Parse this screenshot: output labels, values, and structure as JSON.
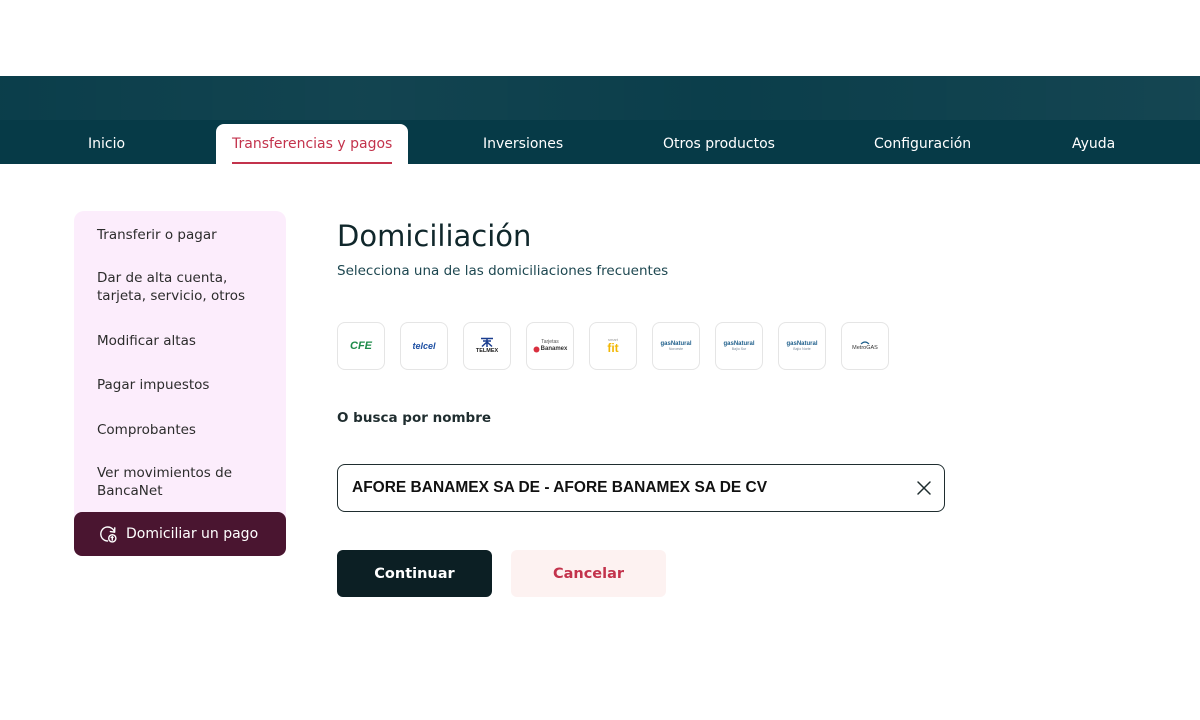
{
  "nav": {
    "items": [
      {
        "label": "Inicio"
      },
      {
        "label": "Transferencias y pagos",
        "active": true
      },
      {
        "label": "Inversiones"
      },
      {
        "label": "Otros productos"
      },
      {
        "label": "Configuración"
      },
      {
        "label": "Ayuda"
      }
    ],
    "active_color": "#c3334c",
    "band_color": "#063a47"
  },
  "sidebar": {
    "items": [
      {
        "label": "Transferir o pagar"
      },
      {
        "label": "Dar de alta cuenta, tarjeta, servicio, otros"
      },
      {
        "label": "Modificar altas"
      },
      {
        "label": "Pagar impuestos"
      },
      {
        "label": "Comprobantes"
      },
      {
        "label": "Ver movimientos de BancaNet"
      },
      {
        "label": "Domiciliar un pago",
        "active": true,
        "icon": "recurring-payment-icon"
      }
    ]
  },
  "main": {
    "title": "Domiciliación",
    "subtitle": "Selecciona una de las domiciliaciones frecuentes",
    "frequent_logos": [
      {
        "name": "CFE",
        "label": "CFE"
      },
      {
        "name": "Telcel",
        "label": "telcel"
      },
      {
        "name": "Telmex",
        "label": "TELMEX"
      },
      {
        "name": "Tarjetas Banamex",
        "label_top": "Tarjetas",
        "label": "Banamex"
      },
      {
        "name": "Smart Fit",
        "label_top": "smart",
        "label": "fit"
      },
      {
        "name": "gasNatural Noroeste",
        "label": "gasNatural",
        "sub": "Noroeste"
      },
      {
        "name": "gasNatural Bajío Sur",
        "label": "gasNatural",
        "sub": "Bajío Sur"
      },
      {
        "name": "gasNatural Bajío Norte",
        "label": "gasNatural",
        "sub": "Bajío Norte"
      },
      {
        "name": "MetroGAS",
        "label": "MetroGAS"
      }
    ],
    "search_label": "O busca por nombre",
    "search_value": "AFORE BANAMEX SA DE - AFORE BANAMEX SA DE CV",
    "continue_label": "Continuar",
    "cancel_label": "Cancelar"
  }
}
